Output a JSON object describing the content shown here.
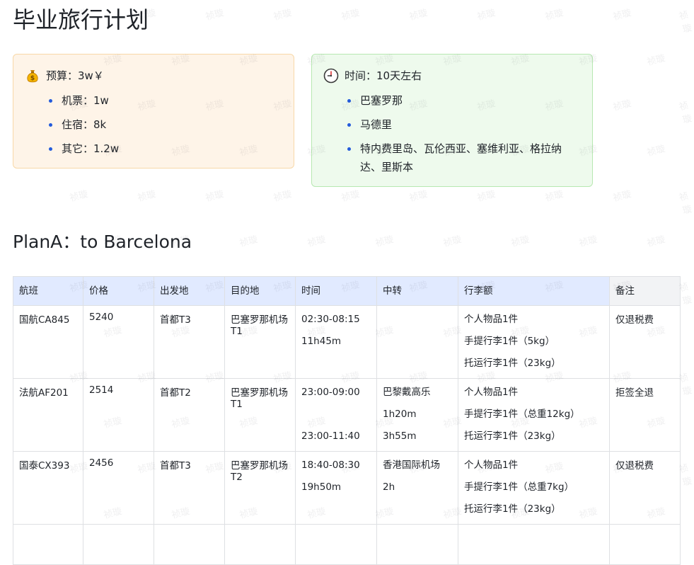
{
  "title": "毕业旅行计划",
  "budget_callout": {
    "icon": "money-bag-icon",
    "heading": "预算：3w￥",
    "items": [
      "机票：1w",
      "住宿：8k",
      "其它：1.2w"
    ]
  },
  "time_callout": {
    "icon": "clock-icon",
    "heading": "时间：10天左右",
    "items": [
      "巴塞罗那",
      "马德里",
      "特内费里岛、瓦伦西亚、塞维利亚、格拉纳达、里斯本"
    ]
  },
  "section_title": "PlanA：to Barcelona",
  "table": {
    "headers": [
      "航班",
      "价格",
      "出发地",
      "目的地",
      "时间",
      "中转",
      "行李额",
      "备注"
    ],
    "rows": [
      {
        "flight": "国航CA845",
        "price": "5240",
        "from": "首都T3",
        "to": "巴塞罗那机场T1",
        "time": [
          "02:30-08:15",
          "11h45m"
        ],
        "transfer": [],
        "baggage": [
          "个人物品1件",
          "手提行李1件（5kg）",
          "托运行李1件（23kg）"
        ],
        "note": "仅退税费"
      },
      {
        "flight": "法航AF201",
        "price": "2514",
        "from": "首都T2",
        "to": "巴塞罗那机场T1",
        "time": [
          "23:00-09:00",
          "",
          "23:00-11:40"
        ],
        "transfer": [
          "巴黎戴高乐",
          "1h20m",
          "3h55m"
        ],
        "baggage": [
          "个人物品1件",
          "手提行李1件（总重12kg）",
          "托运行李1件（23kg）"
        ],
        "note": "拒签全退"
      },
      {
        "flight": "国泰CX393",
        "price": "2456",
        "from": "首都T3",
        "to": "巴塞罗那机场T2",
        "time": [
          "18:40-08:30",
          "19h50m"
        ],
        "transfer": [
          "香港国际机场",
          "2h"
        ],
        "baggage": [
          "个人物品1件",
          "手提行李1件（总重7kg）",
          "托运行李1件（23kg）"
        ],
        "note": "仅退税费"
      }
    ]
  },
  "watermark_text": "祯璇"
}
